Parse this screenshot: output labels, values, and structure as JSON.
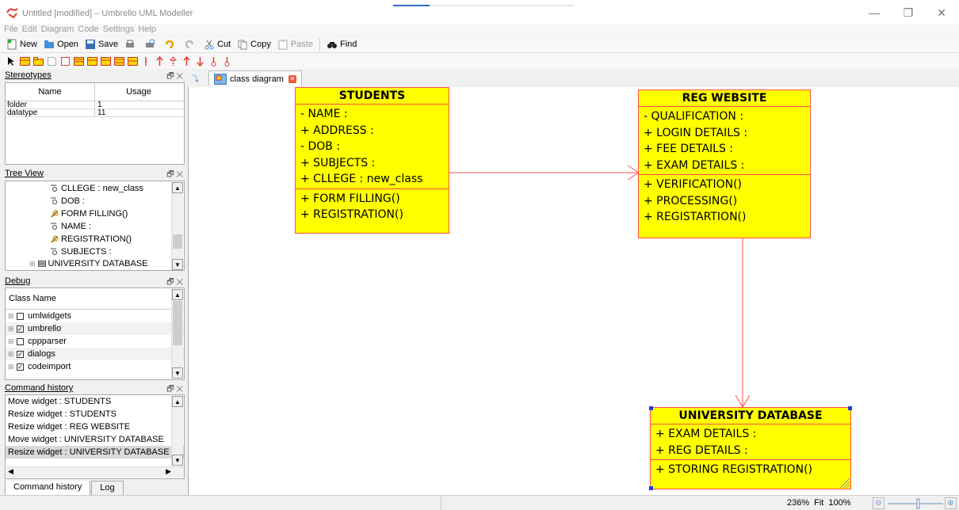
{
  "window": {
    "title": "Untitled [modified] – Umbrello UML Modeller",
    "load_progress": 0.2
  },
  "menubar": [
    "File",
    "Edit",
    "Diagram",
    "Code",
    "Settings",
    "Help"
  ],
  "toolbar": {
    "new_label": "New",
    "open_label": "Open",
    "save_label": "Save",
    "cut_label": "Cut",
    "copy_label": "Copy",
    "paste_label": "Paste",
    "find_label": "Find"
  },
  "stereotypes": {
    "title": "Stereotypes",
    "col_name": "Name",
    "col_usage": "Usage",
    "rows": [
      {
        "name": "folder",
        "usage": "1"
      },
      {
        "name": "datatype",
        "usage": "11"
      }
    ]
  },
  "treeview": {
    "title": "Tree View",
    "items": [
      {
        "label": "CLLEGE : new_class",
        "icon": "attribute-icon"
      },
      {
        "label": "DOB :",
        "icon": "attribute-icon"
      },
      {
        "label": "FORM FILLING()",
        "icon": "operation-icon"
      },
      {
        "label": "NAME :",
        "icon": "attribute-icon"
      },
      {
        "label": "REGISTRATION()",
        "icon": "operation-icon"
      },
      {
        "label": "SUBJECTS :",
        "icon": "attribute-icon"
      },
      {
        "label": "UNIVERSITY DATABASE",
        "icon": "class-icon"
      }
    ]
  },
  "debug": {
    "title": "Debug",
    "column": "Class Name",
    "rows": [
      {
        "label": "umlwidgets",
        "checked": false
      },
      {
        "label": "umbrello",
        "checked": true
      },
      {
        "label": "cppparser",
        "checked": false
      },
      {
        "label": "dialogs",
        "checked": true
      },
      {
        "label": "codeimport",
        "checked": true
      }
    ]
  },
  "command_history": {
    "title": "Command history",
    "items": [
      "Move widget : STUDENTS",
      "Resize widget : STUDENTS",
      "Resize widget : REG WEBSITE",
      "Move widget : UNIVERSITY DATABASE",
      "Resize widget : UNIVERSITY DATABASE"
    ],
    "selected_index": 4
  },
  "dock_tabs": [
    "Command history",
    "Log"
  ],
  "diagram_tab": "class diagram",
  "classes": {
    "students": {
      "name": "STUDENTS",
      "attributes": [
        "- NAME :",
        "+ ADDRESS :",
        "- DOB :",
        "+ SUBJECTS :",
        "+ CLLEGE : new_class"
      ],
      "operations": [
        "+ FORM FILLING()",
        "+ REGISTRATION()"
      ]
    },
    "reg_website": {
      "name": "REG WEBSITE",
      "attributes": [
        "- QUALIFICATION :",
        "+ LOGIN DETAILS :",
        "+ FEE DETAILS :",
        "+ EXAM DETAILS :"
      ],
      "operations": [
        "+ VERIFICATION()",
        "+ PROCESSING()",
        "+ REGISTARTION()"
      ]
    },
    "university_database": {
      "name": "UNIVERSITY DATABASE",
      "attributes": [
        "+ EXAM DETAILS :",
        "+ REG DETAILS :"
      ],
      "operations": [
        "+ STORING REGISTRATION()"
      ]
    }
  },
  "status": {
    "zoom_percent": "236%",
    "fit_label": "Fit",
    "hundred_label": "100%"
  },
  "colors": {
    "class_fill": "#ffff00",
    "class_border": "#ff4d4d",
    "association": "#ff4d4d",
    "selection_handle": "#1f3fd6"
  }
}
